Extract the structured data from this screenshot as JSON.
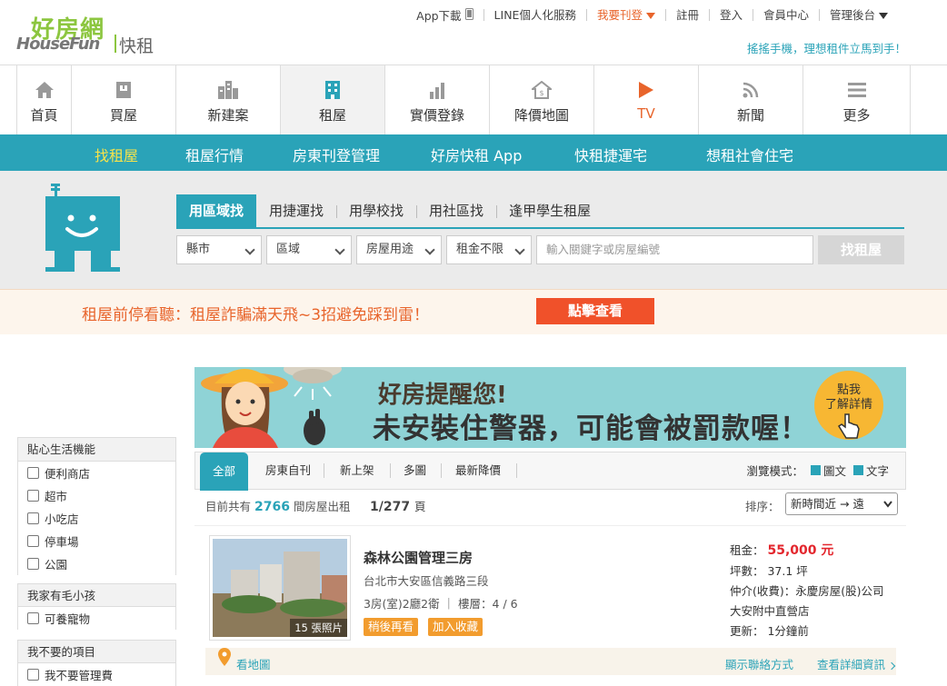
{
  "brand": {
    "logo_zh": "好房網",
    "logo_en": "HouseFun",
    "logo_sub": "快租",
    "tagline": "搖搖手機，理想租件立馬到手！"
  },
  "toplinks": [
    "App下載",
    "LINE個人化服務",
    "我要刊登",
    "註冊",
    "登入",
    "會員中心",
    "管理後台"
  ],
  "mainnav": [
    {
      "label": "首頁",
      "icon": "home-icon"
    },
    {
      "label": "買屋",
      "icon": "house-icon"
    },
    {
      "label": "新建案",
      "icon": "buildings-icon"
    },
    {
      "label": "租屋",
      "icon": "apartment-icon"
    },
    {
      "label": "實價登錄",
      "icon": "bar-chart-icon"
    },
    {
      "label": "降價地圖",
      "icon": "price-house-icon"
    },
    {
      "label": "TV",
      "icon": "play-icon"
    },
    {
      "label": "新聞",
      "icon": "rss-icon"
    },
    {
      "label": "更多",
      "icon": "menu-icon"
    }
  ],
  "subnav": [
    "找租屋",
    "租屋行情",
    "房東刊登管理",
    "好房快租 App",
    "快租捷運宅",
    "想租社會住宅"
  ],
  "search": {
    "tabs": [
      "用區域找",
      "用捷運找",
      "用學校找",
      "用社區找",
      "逢甲學生租屋"
    ],
    "selects": [
      "縣市",
      "區域",
      "房屋用途",
      "租金不限"
    ],
    "keyword_placeholder": "輸入關鍵字或房屋編號",
    "button": "找租屋"
  },
  "notice": {
    "text": "租屋前停看聽：租屋詐騙滿天飛~3招避免踩到雷！",
    "button": "點擊查看"
  },
  "filters": [
    {
      "title": "貼心生活機能",
      "items": [
        "便利商店",
        "超市",
        "小吃店",
        "停車場",
        "公園"
      ]
    },
    {
      "title": "我家有毛小孩",
      "items": [
        "可養寵物"
      ]
    },
    {
      "title": "我不要的項目",
      "items": [
        "我不要管理費"
      ]
    }
  ],
  "banner": {
    "line1": "好房提醒您!",
    "line2": "未安裝住警器，可能會被罰款喔！",
    "button_line1": "點我",
    "button_line2": "了解詳情"
  },
  "list_tabs": [
    "全部",
    "房東自刊",
    "新上架",
    "多圖",
    "最新降價"
  ],
  "view_mode": {
    "label": "瀏覽模式：",
    "options": [
      "圖文",
      "文字"
    ]
  },
  "count": {
    "prefix": "目前共有",
    "value": "2766",
    "suffix": "間房屋出租",
    "page": "1/277",
    "page_unit": "頁"
  },
  "sort": {
    "label": "排序：",
    "value": "新時間近 → 遠"
  },
  "listing": {
    "title": "森林公園管理三房",
    "address": "台北市大安區信義路三段",
    "spec": "3房(室)2廳2衛 ｜ 樓層：4 / 6",
    "photo_count": "15 張照片",
    "tags": [
      "稍後再看",
      "加入收藏"
    ],
    "rent_label": "租金：",
    "rent": "55,000 元",
    "area": "坪數： 37.1 坪",
    "agent": "仲介(收費)：永慶房屋(股)公司",
    "branch": "大安附中直營店",
    "updated": "更新： 1分鐘前",
    "map": "看地圖",
    "contact": "顯示聯絡方式",
    "details": "查看詳細資訊"
  },
  "colors": {
    "teal": "#2aa3b8",
    "orange": "#e8642b",
    "green": "#8cc63f",
    "price": "#e3262d"
  }
}
